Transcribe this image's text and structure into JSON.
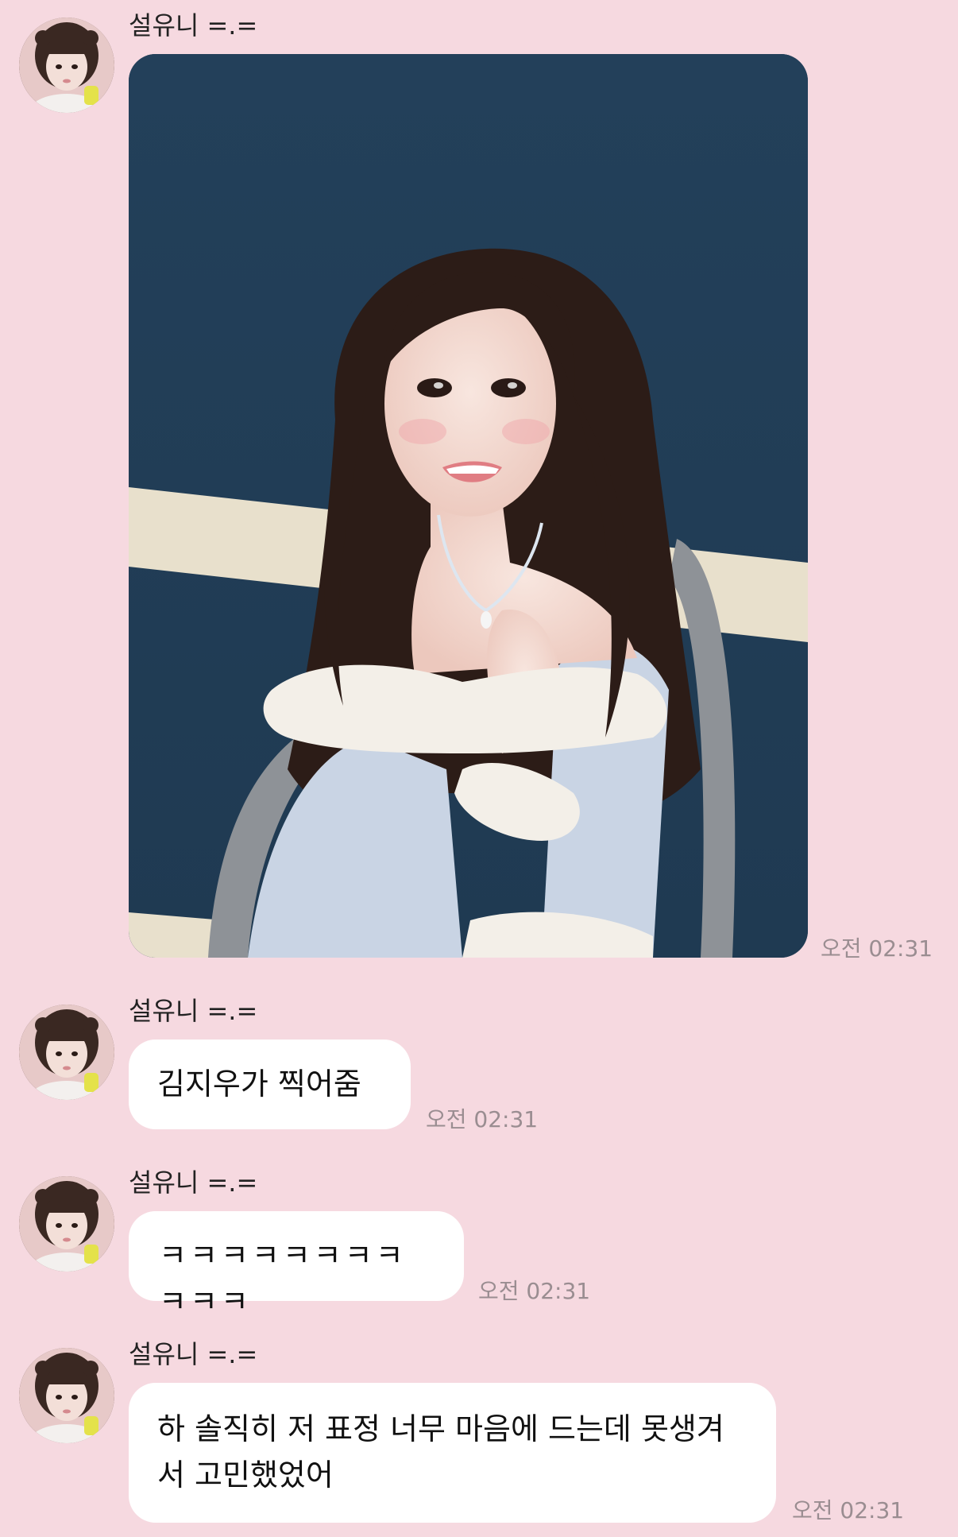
{
  "messages": [
    {
      "type": "image",
      "sender": "설유니 =.=",
      "time": "오전 02:31"
    },
    {
      "type": "text",
      "sender": "설유니 =.=",
      "text": "김지우가 찍어줌",
      "time": "오전 02:31"
    },
    {
      "type": "text",
      "sender": "설유니 =.=",
      "text": "ㅋㅋㅋㅋㅋㅋㅋㅋㅋㅋㅋ",
      "time": "오전 02:31"
    },
    {
      "type": "text",
      "sender": "설유니 =.=",
      "text": "하 솔직히 저 표정 너무 마음에 드는데 못생겨서 고민했었어",
      "time": "오전 02:31"
    }
  ],
  "colors": {
    "background": "#f6d9e0",
    "bubble": "#ffffff",
    "time_text": "#9a8d91"
  }
}
